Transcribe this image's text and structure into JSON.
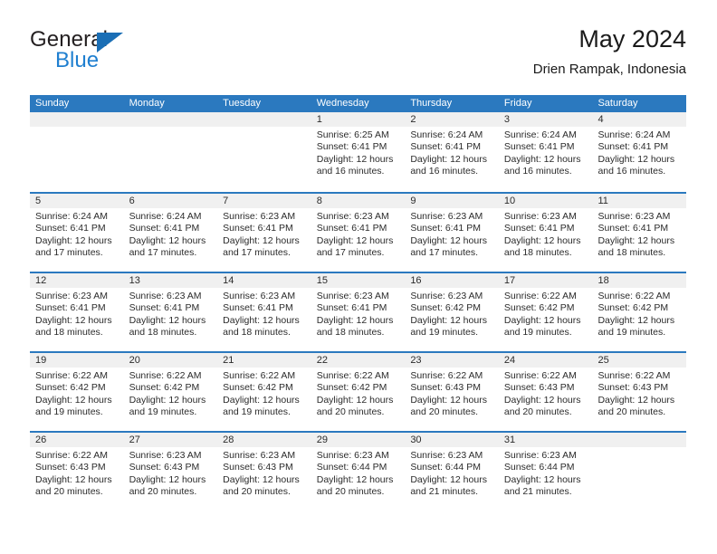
{
  "brand": {
    "word1": "General",
    "word2": "Blue",
    "flag_color": "#1a6eb5",
    "blue_color": "#1f7fd0"
  },
  "header": {
    "title": "May 2024",
    "subtitle": "Drien Rampak, Indonesia"
  },
  "theme": {
    "header_bar": "#2b79bf",
    "day_band": "#f0f0f0",
    "text": "#2b2b2b"
  },
  "weekdays": [
    "Sunday",
    "Monday",
    "Tuesday",
    "Wednesday",
    "Thursday",
    "Friday",
    "Saturday"
  ],
  "weeks": [
    [
      {
        "day": "",
        "sunrise": "",
        "sunset": "",
        "daylight": "",
        "daylight2": ""
      },
      {
        "day": "",
        "sunrise": "",
        "sunset": "",
        "daylight": "",
        "daylight2": ""
      },
      {
        "day": "",
        "sunrise": "",
        "sunset": "",
        "daylight": "",
        "daylight2": ""
      },
      {
        "day": "1",
        "sunrise": "Sunrise: 6:25 AM",
        "sunset": "Sunset: 6:41 PM",
        "daylight": "Daylight: 12 hours",
        "daylight2": "and 16 minutes."
      },
      {
        "day": "2",
        "sunrise": "Sunrise: 6:24 AM",
        "sunset": "Sunset: 6:41 PM",
        "daylight": "Daylight: 12 hours",
        "daylight2": "and 16 minutes."
      },
      {
        "day": "3",
        "sunrise": "Sunrise: 6:24 AM",
        "sunset": "Sunset: 6:41 PM",
        "daylight": "Daylight: 12 hours",
        "daylight2": "and 16 minutes."
      },
      {
        "day": "4",
        "sunrise": "Sunrise: 6:24 AM",
        "sunset": "Sunset: 6:41 PM",
        "daylight": "Daylight: 12 hours",
        "daylight2": "and 16 minutes."
      }
    ],
    [
      {
        "day": "5",
        "sunrise": "Sunrise: 6:24 AM",
        "sunset": "Sunset: 6:41 PM",
        "daylight": "Daylight: 12 hours",
        "daylight2": "and 17 minutes."
      },
      {
        "day": "6",
        "sunrise": "Sunrise: 6:24 AM",
        "sunset": "Sunset: 6:41 PM",
        "daylight": "Daylight: 12 hours",
        "daylight2": "and 17 minutes."
      },
      {
        "day": "7",
        "sunrise": "Sunrise: 6:23 AM",
        "sunset": "Sunset: 6:41 PM",
        "daylight": "Daylight: 12 hours",
        "daylight2": "and 17 minutes."
      },
      {
        "day": "8",
        "sunrise": "Sunrise: 6:23 AM",
        "sunset": "Sunset: 6:41 PM",
        "daylight": "Daylight: 12 hours",
        "daylight2": "and 17 minutes."
      },
      {
        "day": "9",
        "sunrise": "Sunrise: 6:23 AM",
        "sunset": "Sunset: 6:41 PM",
        "daylight": "Daylight: 12 hours",
        "daylight2": "and 17 minutes."
      },
      {
        "day": "10",
        "sunrise": "Sunrise: 6:23 AM",
        "sunset": "Sunset: 6:41 PM",
        "daylight": "Daylight: 12 hours",
        "daylight2": "and 18 minutes."
      },
      {
        "day": "11",
        "sunrise": "Sunrise: 6:23 AM",
        "sunset": "Sunset: 6:41 PM",
        "daylight": "Daylight: 12 hours",
        "daylight2": "and 18 minutes."
      }
    ],
    [
      {
        "day": "12",
        "sunrise": "Sunrise: 6:23 AM",
        "sunset": "Sunset: 6:41 PM",
        "daylight": "Daylight: 12 hours",
        "daylight2": "and 18 minutes."
      },
      {
        "day": "13",
        "sunrise": "Sunrise: 6:23 AM",
        "sunset": "Sunset: 6:41 PM",
        "daylight": "Daylight: 12 hours",
        "daylight2": "and 18 minutes."
      },
      {
        "day": "14",
        "sunrise": "Sunrise: 6:23 AM",
        "sunset": "Sunset: 6:41 PM",
        "daylight": "Daylight: 12 hours",
        "daylight2": "and 18 minutes."
      },
      {
        "day": "15",
        "sunrise": "Sunrise: 6:23 AM",
        "sunset": "Sunset: 6:41 PM",
        "daylight": "Daylight: 12 hours",
        "daylight2": "and 18 minutes."
      },
      {
        "day": "16",
        "sunrise": "Sunrise: 6:23 AM",
        "sunset": "Sunset: 6:42 PM",
        "daylight": "Daylight: 12 hours",
        "daylight2": "and 19 minutes."
      },
      {
        "day": "17",
        "sunrise": "Sunrise: 6:22 AM",
        "sunset": "Sunset: 6:42 PM",
        "daylight": "Daylight: 12 hours",
        "daylight2": "and 19 minutes."
      },
      {
        "day": "18",
        "sunrise": "Sunrise: 6:22 AM",
        "sunset": "Sunset: 6:42 PM",
        "daylight": "Daylight: 12 hours",
        "daylight2": "and 19 minutes."
      }
    ],
    [
      {
        "day": "19",
        "sunrise": "Sunrise: 6:22 AM",
        "sunset": "Sunset: 6:42 PM",
        "daylight": "Daylight: 12 hours",
        "daylight2": "and 19 minutes."
      },
      {
        "day": "20",
        "sunrise": "Sunrise: 6:22 AM",
        "sunset": "Sunset: 6:42 PM",
        "daylight": "Daylight: 12 hours",
        "daylight2": "and 19 minutes."
      },
      {
        "day": "21",
        "sunrise": "Sunrise: 6:22 AM",
        "sunset": "Sunset: 6:42 PM",
        "daylight": "Daylight: 12 hours",
        "daylight2": "and 19 minutes."
      },
      {
        "day": "22",
        "sunrise": "Sunrise: 6:22 AM",
        "sunset": "Sunset: 6:42 PM",
        "daylight": "Daylight: 12 hours",
        "daylight2": "and 20 minutes."
      },
      {
        "day": "23",
        "sunrise": "Sunrise: 6:22 AM",
        "sunset": "Sunset: 6:43 PM",
        "daylight": "Daylight: 12 hours",
        "daylight2": "and 20 minutes."
      },
      {
        "day": "24",
        "sunrise": "Sunrise: 6:22 AM",
        "sunset": "Sunset: 6:43 PM",
        "daylight": "Daylight: 12 hours",
        "daylight2": "and 20 minutes."
      },
      {
        "day": "25",
        "sunrise": "Sunrise: 6:22 AM",
        "sunset": "Sunset: 6:43 PM",
        "daylight": "Daylight: 12 hours",
        "daylight2": "and 20 minutes."
      }
    ],
    [
      {
        "day": "26",
        "sunrise": "Sunrise: 6:22 AM",
        "sunset": "Sunset: 6:43 PM",
        "daylight": "Daylight: 12 hours",
        "daylight2": "and 20 minutes."
      },
      {
        "day": "27",
        "sunrise": "Sunrise: 6:23 AM",
        "sunset": "Sunset: 6:43 PM",
        "daylight": "Daylight: 12 hours",
        "daylight2": "and 20 minutes."
      },
      {
        "day": "28",
        "sunrise": "Sunrise: 6:23 AM",
        "sunset": "Sunset: 6:43 PM",
        "daylight": "Daylight: 12 hours",
        "daylight2": "and 20 minutes."
      },
      {
        "day": "29",
        "sunrise": "Sunrise: 6:23 AM",
        "sunset": "Sunset: 6:44 PM",
        "daylight": "Daylight: 12 hours",
        "daylight2": "and 20 minutes."
      },
      {
        "day": "30",
        "sunrise": "Sunrise: 6:23 AM",
        "sunset": "Sunset: 6:44 PM",
        "daylight": "Daylight: 12 hours",
        "daylight2": "and 21 minutes."
      },
      {
        "day": "31",
        "sunrise": "Sunrise: 6:23 AM",
        "sunset": "Sunset: 6:44 PM",
        "daylight": "Daylight: 12 hours",
        "daylight2": "and 21 minutes."
      },
      {
        "day": "",
        "sunrise": "",
        "sunset": "",
        "daylight": "",
        "daylight2": ""
      }
    ]
  ]
}
